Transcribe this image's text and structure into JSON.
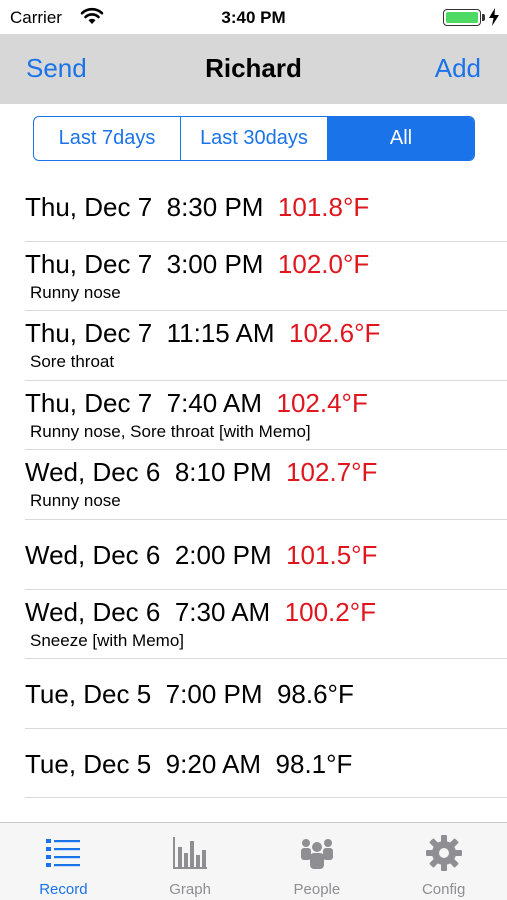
{
  "status_bar": {
    "carrier": "Carrier",
    "time": "3:40 PM",
    "battery_level": 1.0
  },
  "nav": {
    "left_button": "Send",
    "title": "Richard",
    "right_button": "Add"
  },
  "segments": [
    {
      "label": "Last 7days",
      "selected": false
    },
    {
      "label": "Last 30days",
      "selected": false
    },
    {
      "label": "All",
      "selected": true
    }
  ],
  "records": [
    {
      "day": "Thu, Dec 7",
      "time": "8:30 PM",
      "temp": "101.8°F",
      "fever": true,
      "note": ""
    },
    {
      "day": "Thu, Dec 7",
      "time": "3:00 PM",
      "temp": "102.0°F",
      "fever": true,
      "note": "Runny nose"
    },
    {
      "day": "Thu, Dec 7",
      "time": "11:15 AM",
      "temp": "102.6°F",
      "fever": true,
      "note": "Sore throat"
    },
    {
      "day": "Thu, Dec 7",
      "time": "7:40 AM",
      "temp": "102.4°F",
      "fever": true,
      "note": "Runny nose, Sore throat [with Memo]"
    },
    {
      "day": "Wed, Dec 6",
      "time": "8:10 PM",
      "temp": "102.7°F",
      "fever": true,
      "note": "Runny nose"
    },
    {
      "day": "Wed, Dec 6",
      "time": "2:00 PM",
      "temp": "101.5°F",
      "fever": true,
      "note": ""
    },
    {
      "day": "Wed, Dec 6",
      "time": "7:30 AM",
      "temp": "100.2°F",
      "fever": true,
      "note": "Sneeze [with Memo]"
    },
    {
      "day": "Tue, Dec 5",
      "time": "7:00 PM",
      "temp": "98.6°F",
      "fever": false,
      "note": ""
    },
    {
      "day": "Tue, Dec 5",
      "time": "9:20 AM",
      "temp": "98.1°F",
      "fever": false,
      "note": ""
    }
  ],
  "tabs": [
    {
      "label": "Record",
      "icon": "list-icon",
      "selected": true
    },
    {
      "label": "Graph",
      "icon": "bar-chart-icon",
      "selected": false
    },
    {
      "label": "People",
      "icon": "people-icon",
      "selected": false
    },
    {
      "label": "Config",
      "icon": "gear-icon",
      "selected": false
    }
  ],
  "colors": {
    "accent": "#1a73e8",
    "fever": "#e0161f",
    "tab_inactive": "#8e8e93"
  }
}
